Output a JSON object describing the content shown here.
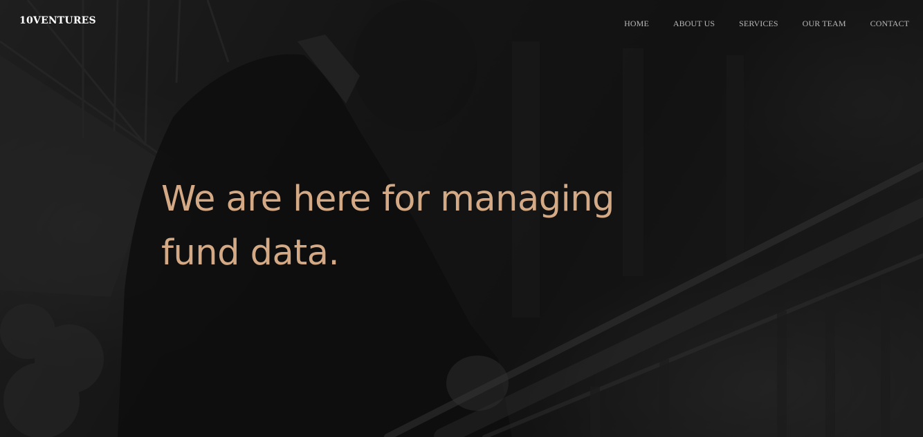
{
  "brand": {
    "name": "10VENTURES"
  },
  "nav": {
    "items": [
      {
        "label": "HOME"
      },
      {
        "label": "ABOUT US"
      },
      {
        "label": "SERVICES"
      },
      {
        "label": "OUR TEAM"
      },
      {
        "label": "CONTACT"
      }
    ]
  },
  "hero": {
    "headline": "We are here for managing fund data."
  },
  "colors": {
    "headline": "#d4a985",
    "brand": "#ffffff",
    "nav_link": "#b9b9b9",
    "background": "#1b1b1b"
  }
}
